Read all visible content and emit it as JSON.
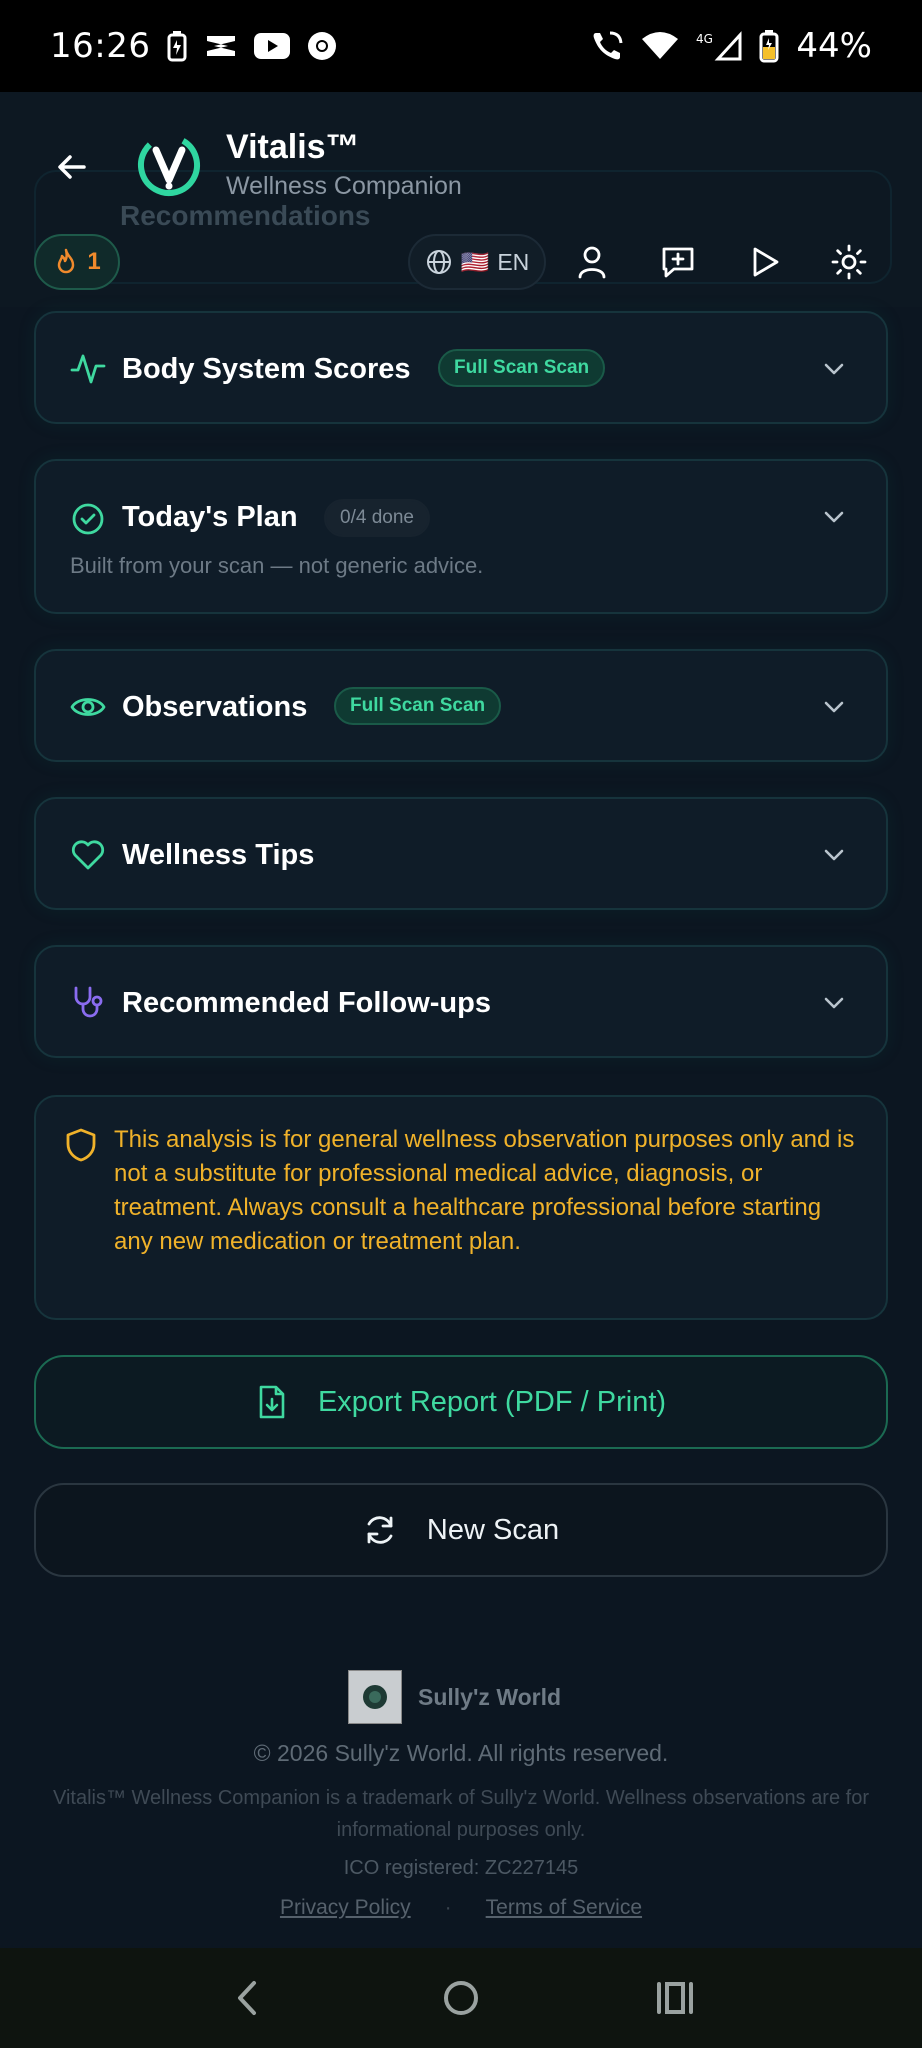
{
  "status_bar": {
    "time": "16:26",
    "battery_pct": "44%",
    "network": "4G"
  },
  "header": {
    "app_title": "Vitalis™",
    "app_subtitle": "Wellness Companion",
    "behind_label": "Recommendations",
    "streak_count": "1",
    "language_flag": "🇺🇸",
    "language_code": "EN"
  },
  "cards": [
    {
      "title": "Body System Scores",
      "badge": "Full Scan Scan",
      "icon": "activity-icon"
    },
    {
      "title": "Today's Plan",
      "badge": "0/4 done",
      "subtitle": "Built from your scan — not generic advice.",
      "icon": "check-circle-icon"
    },
    {
      "title": "Observations",
      "badge": "Full Scan Scan",
      "icon": "eye-icon"
    },
    {
      "title": "Wellness Tips",
      "icon": "heart-icon"
    },
    {
      "title": "Recommended Follow-ups",
      "icon": "stethoscope-icon"
    }
  ],
  "disclaimer": "This analysis is for general wellness observation purposes only and is not a substitute for professional medical advice, diagnosis, or treatment. Always consult a healthcare professional before starting any new medication or treatment plan.",
  "buttons": {
    "export": "Export Report (PDF / Print)",
    "new_scan": "New Scan"
  },
  "footer": {
    "brand": "Sully'z World",
    "copyright": "© 2026 Sully'z World. All rights reserved.",
    "trademark": "Vitalis™ Wellness Companion is a trademark of Sully'z World. Wellness observations are for informational purposes only.",
    "ico": "ICO registered: ZC227145",
    "privacy": "Privacy Policy",
    "separator": "·",
    "terms": "Terms of Service"
  },
  "colors": {
    "accent_green": "#3fd9a0",
    "warning_amber": "#f0b22a",
    "streak_orange": "#f08a2c",
    "stethoscope_purple": "#8a6cf0",
    "background": "#0c1621"
  }
}
